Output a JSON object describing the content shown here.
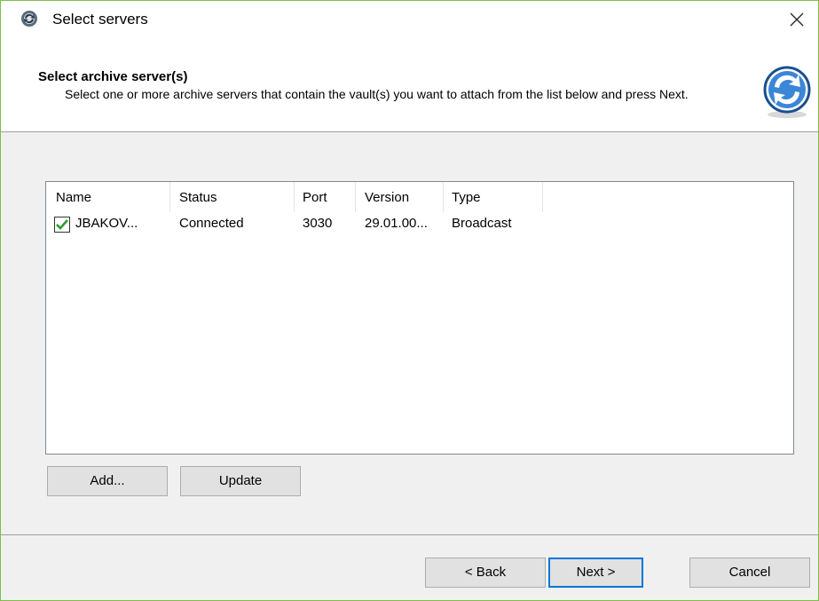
{
  "window": {
    "title": "Select servers"
  },
  "header": {
    "title": "Select archive server(s)",
    "description": "Select one or more archive servers that contain the vault(s) you want to attach from the list below and press Next."
  },
  "list": {
    "columns": [
      "Name",
      "Status",
      "Port",
      "Version",
      "Type"
    ],
    "rows": [
      {
        "checked": true,
        "name": "JBAKOV...",
        "status": "Connected",
        "port": "3030",
        "version": "29.01.00...",
        "type": "Broadcast"
      }
    ]
  },
  "buttons": {
    "add": "Add...",
    "update": "Update",
    "back": "< Back",
    "next": "Next >",
    "cancel": "Cancel"
  },
  "icons": {
    "app": "wizard-refresh-icon",
    "close": "close-icon",
    "header": "blue-sync-arrows-icon",
    "check": "checkmark-icon"
  },
  "colors": {
    "window_border": "#7cbf4a",
    "primary_button_border": "#0078d7",
    "checkmark": "#2a9d2a"
  }
}
